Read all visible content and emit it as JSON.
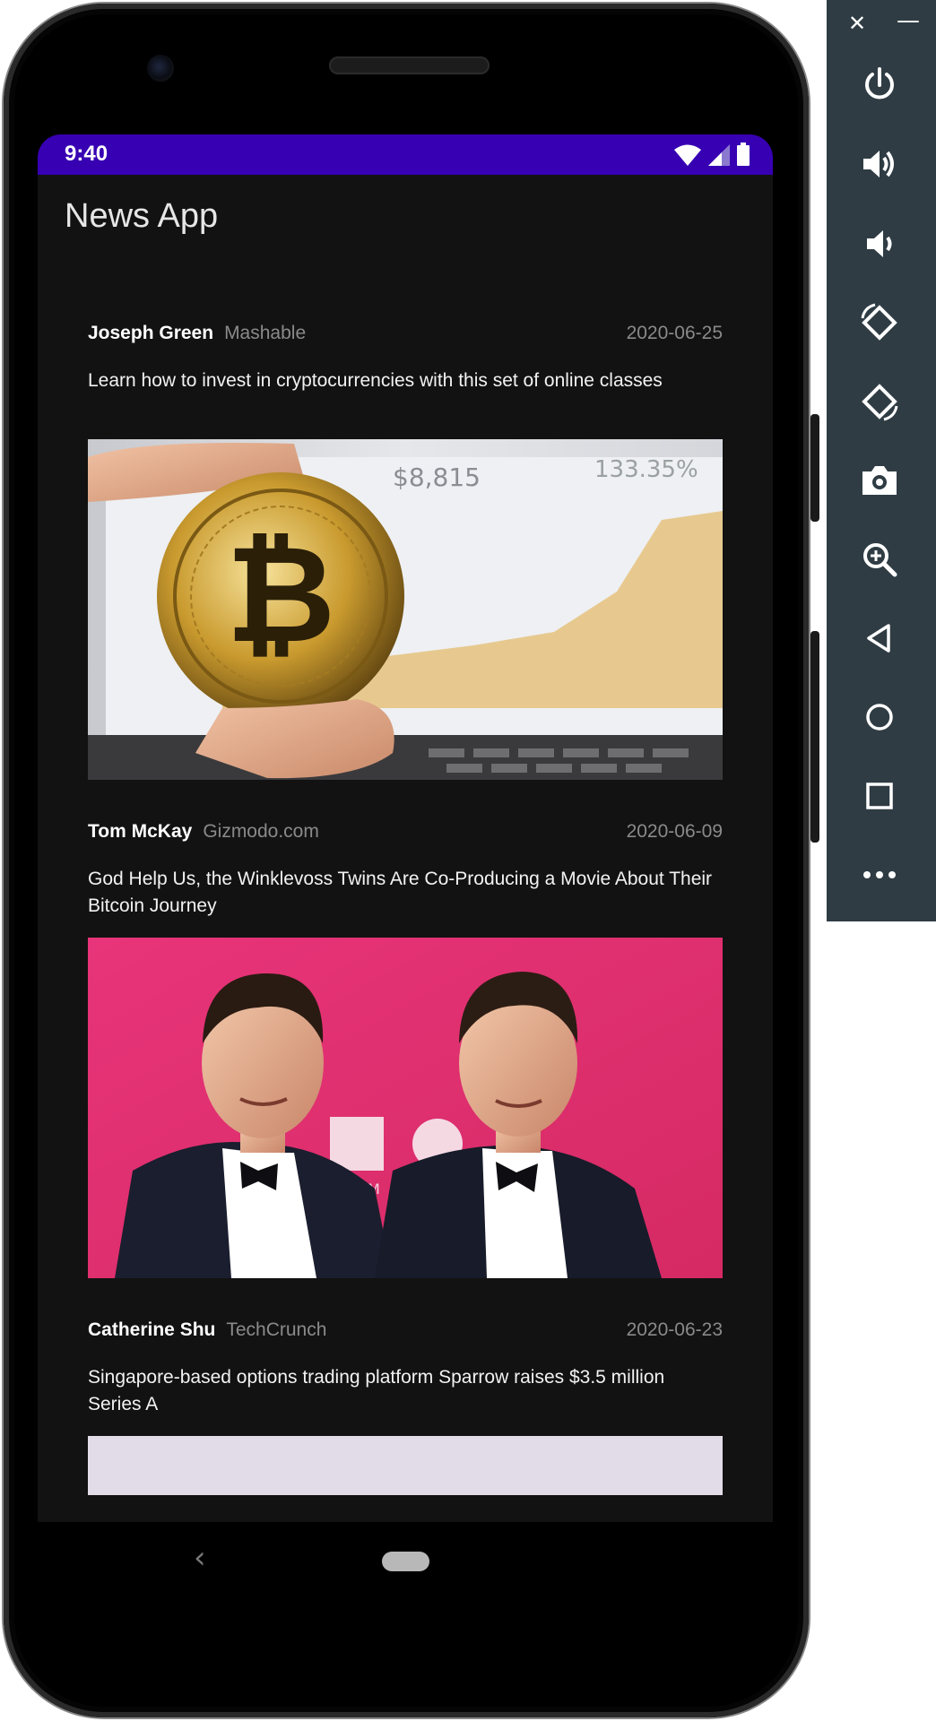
{
  "status_bar": {
    "time": "9:40"
  },
  "app": {
    "title": "News App"
  },
  "articles": [
    {
      "author": "Joseph Green",
      "source": "Mashable",
      "date": "2020-06-25",
      "headline": "Learn how to invest in cryptocurrencies with this set of online classes",
      "image": "bitcoin-coin-photo",
      "overlay": {
        "price": "$8,815",
        "percent": "133.35%"
      }
    },
    {
      "author": "Tom McKay",
      "source": "Gizmodo.com",
      "date": "2020-06-09",
      "headline": "God Help Us, the Winklevoss Twins Are Co-Producing a Movie About Their Bitcoin Journey",
      "image": "twins-photo",
      "overlay": {
        "backdrop_text": "THE M"
      }
    },
    {
      "author": "Catherine Shu",
      "source": "TechCrunch",
      "date": "2020-06-23",
      "headline": "Singapore-based options trading platform Sparrow raises $3.5 million Series A",
      "image": "sparrow-thumbnail"
    }
  ],
  "nav": {
    "back": "‹"
  },
  "emulator": {
    "close": "✕",
    "minimize": "—",
    "buttons": [
      {
        "name": "power-icon"
      },
      {
        "name": "volume-up-icon"
      },
      {
        "name": "volume-down-icon"
      },
      {
        "name": "rotate-left-icon"
      },
      {
        "name": "rotate-right-icon"
      },
      {
        "name": "camera-icon"
      },
      {
        "name": "zoom-icon"
      },
      {
        "name": "back-triangle-icon"
      },
      {
        "name": "home-circle-icon"
      },
      {
        "name": "overview-square-icon"
      },
      {
        "name": "more-icon"
      }
    ]
  },
  "colors": {
    "status_bar": "#3700b3",
    "background": "#121212",
    "emulator_panel": "#2f3c44",
    "pink_backdrop": "#e1336e"
  }
}
